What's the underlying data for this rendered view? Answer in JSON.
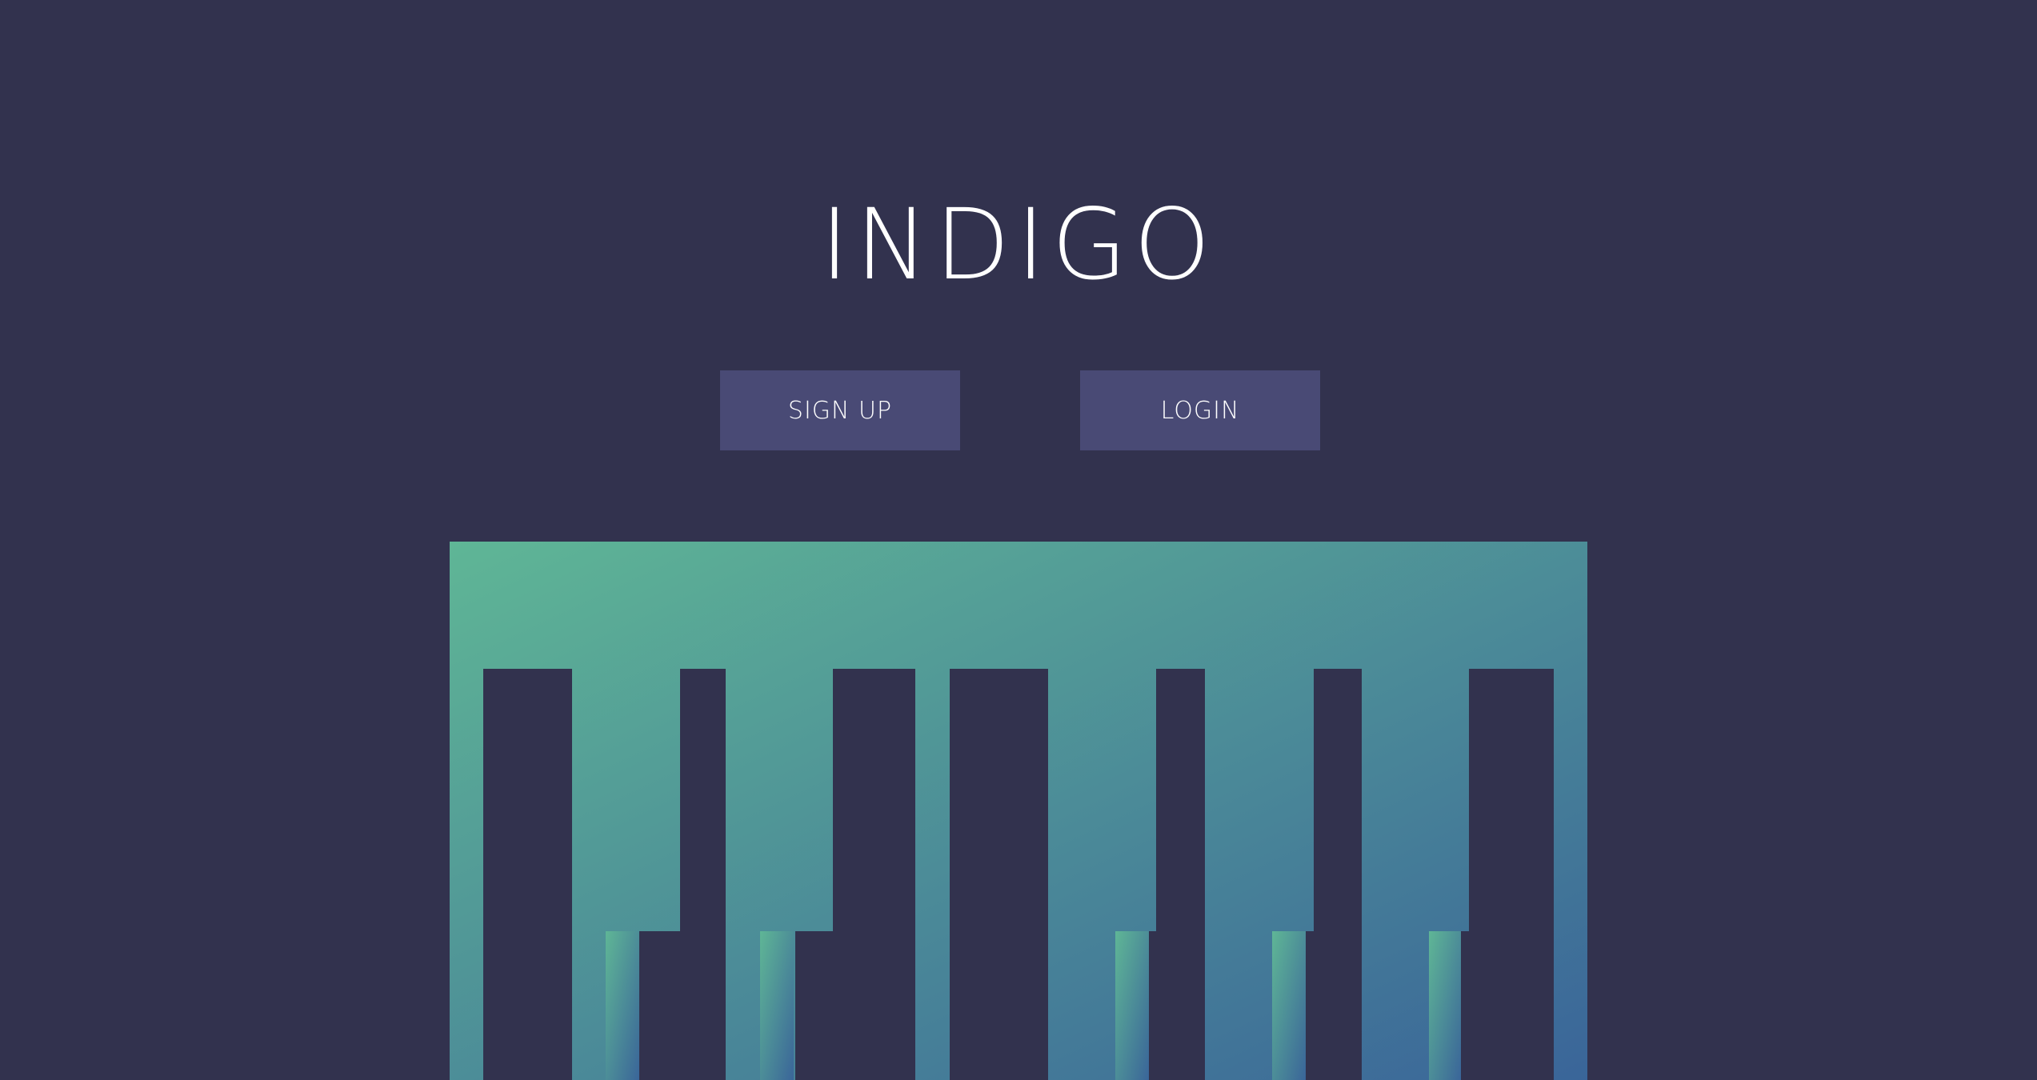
{
  "app": {
    "title": "INDIGO"
  },
  "actions": {
    "signup_label": "SIGN UP",
    "login_label": "LOGIN"
  },
  "theme": {
    "background": "#32324e",
    "button_bg": "#494a75",
    "text": "#ffffff",
    "gradient_start": "#5fb696",
    "gradient_end": "#3a6599"
  },
  "hero": {
    "graphic_icon": "piano-keys-icon"
  }
}
